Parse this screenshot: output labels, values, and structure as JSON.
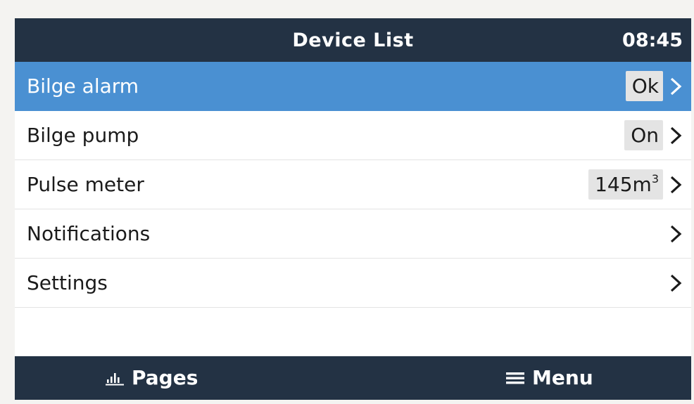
{
  "header": {
    "title": "Device List",
    "clock": "08:45"
  },
  "list": {
    "items": [
      {
        "label": "Bilge alarm",
        "value": "Ok",
        "selected": true
      },
      {
        "label": "Bilge pump",
        "value": "On",
        "selected": false
      },
      {
        "label": "Pulse meter",
        "value": "145m",
        "value_sup": "3",
        "selected": false
      },
      {
        "label": "Notifications",
        "selected": false
      },
      {
        "label": "Settings",
        "selected": false
      }
    ]
  },
  "footer": {
    "pages_label": "Pages",
    "menu_label": "Menu",
    "pages_icon": "bar-chart-icon",
    "menu_icon": "hamburger-menu-icon"
  },
  "colors": {
    "header_bg": "#233244",
    "selected_bg": "#4a90d2",
    "value_badge_bg": "#e4e4e4"
  }
}
